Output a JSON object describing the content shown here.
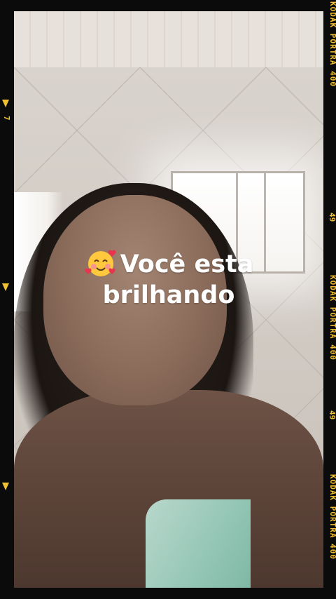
{
  "sticker": {
    "line1": "Você esta",
    "line2": "brilhando",
    "emoji_icon": "smiling-face-with-hearts-icon"
  },
  "film": {
    "label": "KODAK PORTRA 400",
    "frame_number": "49",
    "left_number": "7",
    "accent_color": "#f0c233"
  }
}
